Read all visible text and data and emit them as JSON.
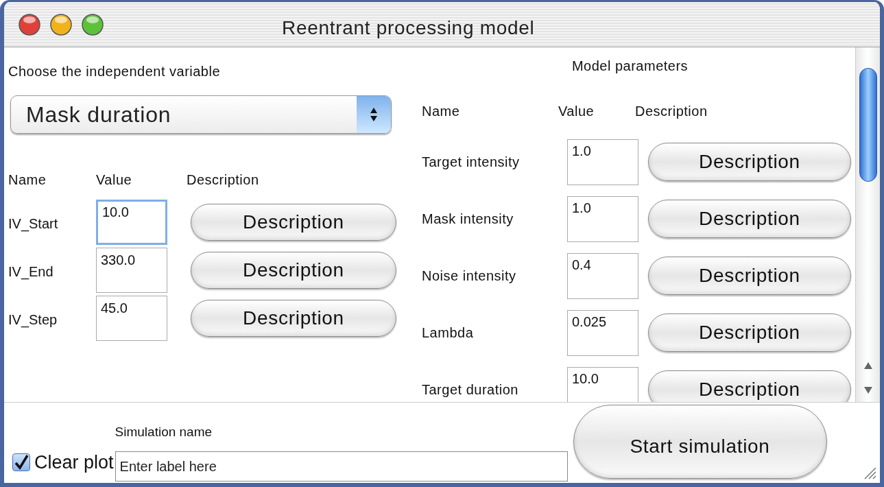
{
  "window": {
    "title": "Reentrant processing model"
  },
  "independent_variable": {
    "label": "Choose the independent variable",
    "value": "Mask duration"
  },
  "iv_table": {
    "columns": [
      "Name",
      "Value",
      "Description"
    ],
    "rows": [
      {
        "name": "IV_Start",
        "value": "10.0",
        "button": "Description",
        "focused": true
      },
      {
        "name": "IV_End",
        "value": "330.0",
        "button": "Description",
        "focused": false
      },
      {
        "name": "IV_Step",
        "value": "45.0",
        "button": "Description",
        "focused": false
      }
    ]
  },
  "model_parameters": {
    "title": "Model parameters",
    "columns": [
      "Name",
      "Value",
      "Description"
    ],
    "rows": [
      {
        "name": "Target intensity",
        "value": "1.0",
        "button": "Description"
      },
      {
        "name": "Mask intensity",
        "value": "1.0",
        "button": "Description"
      },
      {
        "name": "Noise intensity",
        "value": "0.4",
        "button": "Description"
      },
      {
        "name": "Lambda",
        "value": "0.025",
        "button": "Description"
      },
      {
        "name": "Target duration",
        "value": "10.0",
        "button": "Description"
      }
    ]
  },
  "clear_plot": {
    "label": "Clear plot",
    "checked": true
  },
  "simulation_name": {
    "label": "Simulation name",
    "placeholder": "Enter label here"
  },
  "start_button": "Start simulation"
}
